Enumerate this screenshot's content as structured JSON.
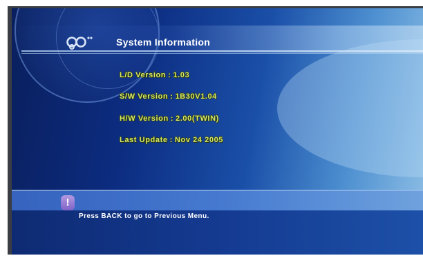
{
  "screen": {
    "title": "System Information",
    "logo_icon": "circles-logo-icon",
    "colors": {
      "background_dark": "#0a1f5c",
      "background_light": "#8fc0e6",
      "info_text": "#d7e86a",
      "title_text": "#ffffff",
      "hint_icon": "#8f74d2"
    }
  },
  "info": {
    "ld_label": "L/D Version",
    "ld_value": "1.03",
    "sw_label": "S/W Version",
    "sw_value": "1B30V1.04",
    "hw_label": "H/W Version",
    "hw_value": "2.00(TWIN)",
    "update_label": "Last Update",
    "update_value": "Nov 24 2005",
    "separator": ":"
  },
  "footer": {
    "hint_icon": "exclamation-icon",
    "hint_icon_glyph": "!",
    "hint_text": "Press BACK to go to Previous Menu."
  }
}
